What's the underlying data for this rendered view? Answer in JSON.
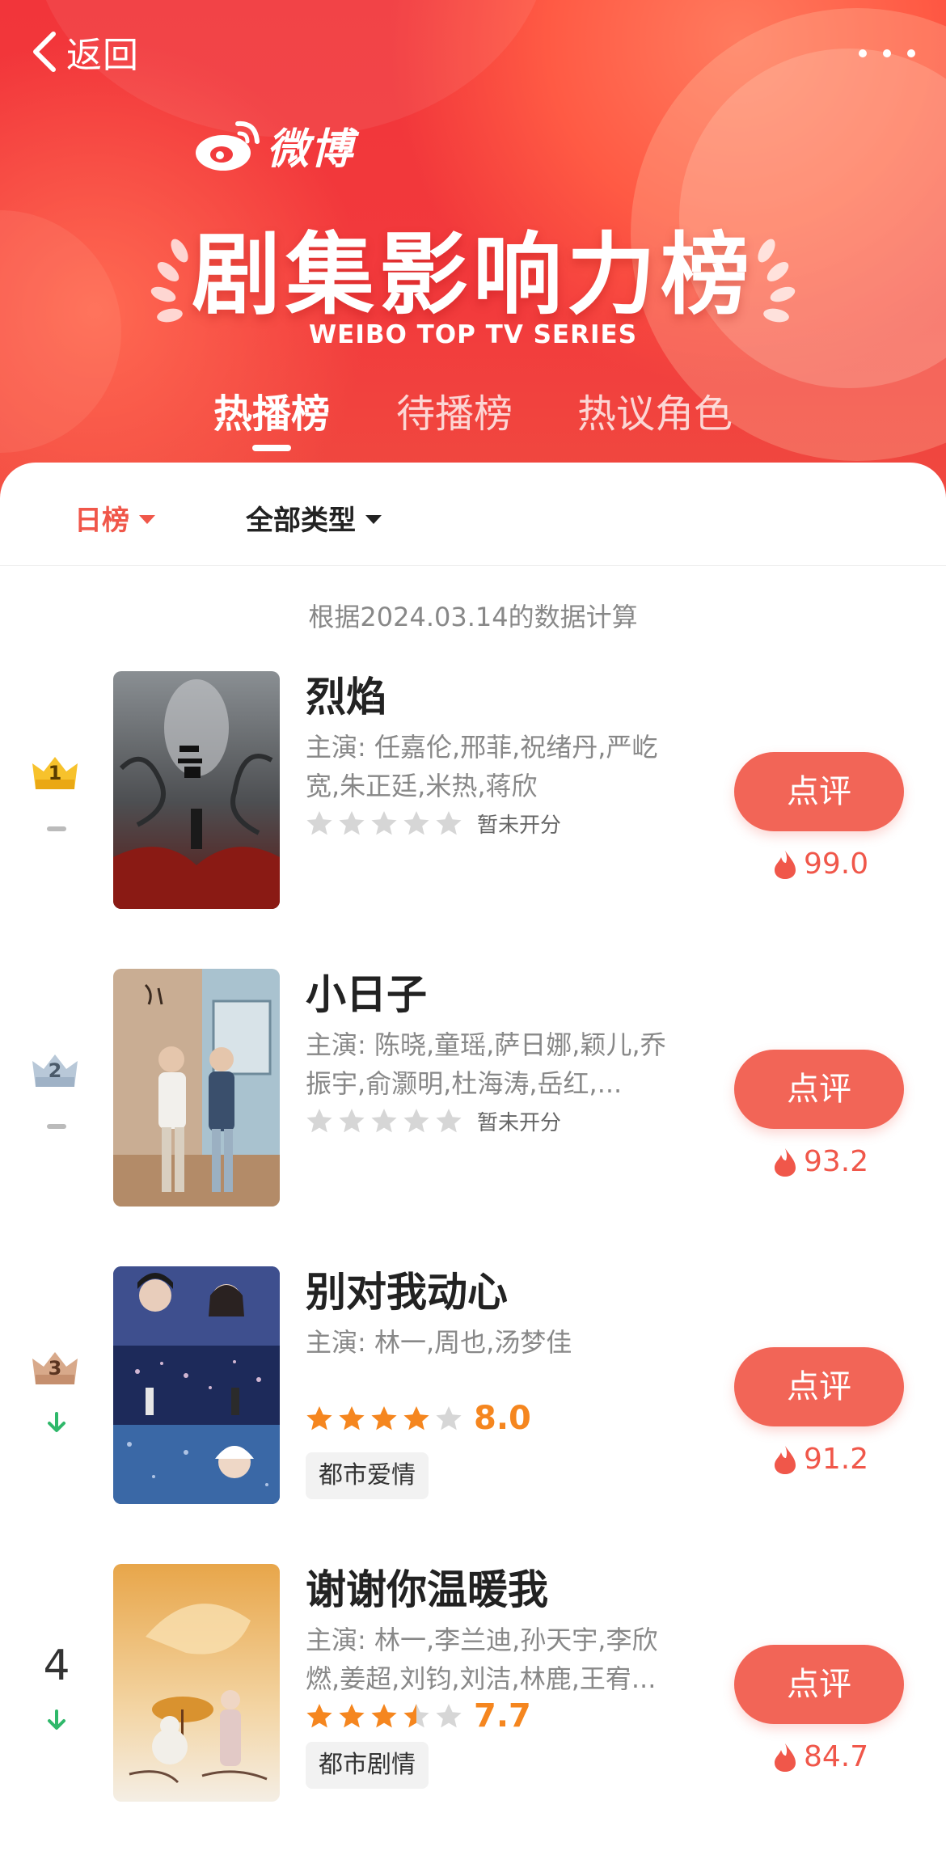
{
  "header": {
    "back_label": "返回",
    "logo_text": "微博",
    "title": "剧集影响力榜",
    "subtitle": "WEIBO TOP TV SERIES"
  },
  "tabs": [
    {
      "label": "热播榜",
      "active": true
    },
    {
      "label": "待播榜",
      "active": false
    },
    {
      "label": "热议角色",
      "active": false
    }
  ],
  "filters": {
    "period": "日榜",
    "category": "全部类型"
  },
  "data_note": "根据2024.03.14的数据计算",
  "colors": {
    "brand_red": "#f23a3c",
    "button_red": "#f26557",
    "star_orange": "#f5861f",
    "heat_red": "#f0574a"
  },
  "items": [
    {
      "rank": "1",
      "rank_style": "gold-crown",
      "trend": "flat",
      "title": "烈焰",
      "cast": "主演: 任嘉伦,邢菲,祝绪丹,严屹宽,朱正廷,米热,蒋欣",
      "stars": 0,
      "score_text": "暂未开分",
      "genre": "",
      "review_label": "点评",
      "heat": "99.0"
    },
    {
      "rank": "2",
      "rank_style": "silver-crown",
      "trend": "flat",
      "title": "小日子",
      "cast": "主演: 陈晓,童瑶,萨日娜,颖儿,乔振宇,俞灏明,杜海涛,岳红,...",
      "stars": 0,
      "score_text": "暂未开分",
      "genre": "",
      "review_label": "点评",
      "heat": "93.2"
    },
    {
      "rank": "3",
      "rank_style": "bronze-crown",
      "trend": "down",
      "title": "别对我动心",
      "cast": "主演: 林一,周也,汤梦佳",
      "stars": 4,
      "score_text": "8.0",
      "genre": "都市爱情",
      "review_label": "点评",
      "heat": "91.2"
    },
    {
      "rank": "4",
      "rank_style": "plain",
      "trend": "down",
      "title": "谢谢你温暖我",
      "cast": "主演: 林一,李兰迪,孙天宇,李欣燃,姜超,刘钧,刘洁,林鹿,王宥...",
      "stars": 3.5,
      "score_text": "7.7",
      "genre": "都市剧情",
      "review_label": "点评",
      "heat": "84.7"
    }
  ]
}
